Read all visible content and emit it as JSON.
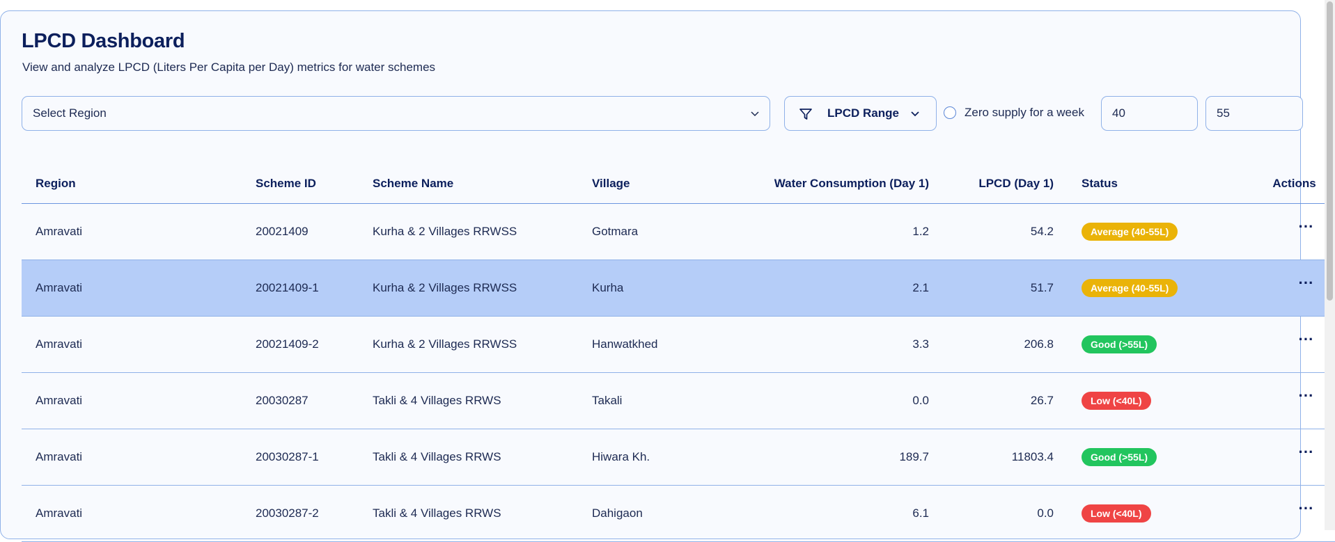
{
  "header": {
    "title": "LPCD Dashboard",
    "subtitle": "View and analyze LPCD (Liters Per Capita per Day) metrics for water schemes"
  },
  "filters": {
    "region_select": {
      "label": "Select Region",
      "icon": "chevron-down-icon"
    },
    "lpcd_range": {
      "label": "LPCD Range",
      "icon": "filter-icon",
      "chevron": "chevron-down-icon"
    },
    "zero_supply": {
      "label": "Zero supply for a week",
      "checked": false
    },
    "min_value": "40",
    "max_value": "55"
  },
  "table": {
    "columns": [
      "Region",
      "Scheme ID",
      "Scheme Name",
      "Village",
      "Water Consumption (Day 1)",
      "LPCD (Day 1)",
      "Status",
      "Actions"
    ],
    "rows": [
      {
        "region": "Amravati",
        "scheme_id": "20021409",
        "scheme_name": "Kurha & 2 Villages RRWSS",
        "village": "Gotmara",
        "water": "1.2",
        "lpcd": "54.2",
        "status": "Average (40-55L)",
        "status_type": "average",
        "selected": false
      },
      {
        "region": "Amravati",
        "scheme_id": "20021409-1",
        "scheme_name": "Kurha & 2 Villages RRWSS",
        "village": "Kurha",
        "water": "2.1",
        "lpcd": "51.7",
        "status": "Average (40-55L)",
        "status_type": "average",
        "selected": true
      },
      {
        "region": "Amravati",
        "scheme_id": "20021409-2",
        "scheme_name": "Kurha & 2 Villages RRWSS",
        "village": "Hanwatkhed",
        "water": "3.3",
        "lpcd": "206.8",
        "status": "Good (>55L)",
        "status_type": "good",
        "selected": false
      },
      {
        "region": "Amravati",
        "scheme_id": "20030287",
        "scheme_name": "Takli & 4 Villages RRWS",
        "village": "Takali",
        "water": "0.0",
        "lpcd": "26.7",
        "status": "Low (<40L)",
        "status_type": "low",
        "selected": false
      },
      {
        "region": "Amravati",
        "scheme_id": "20030287-1",
        "scheme_name": "Takli & 4 Villages RRWS",
        "village": "Hiwara Kh.",
        "water": "189.7",
        "lpcd": "11803.4",
        "status": "Good (>55L)",
        "status_type": "good",
        "selected": false
      },
      {
        "region": "Amravati",
        "scheme_id": "20030287-2",
        "scheme_name": "Takli & 4 Villages RRWS",
        "village": "Dahigaon",
        "water": "6.1",
        "lpcd": "0.0",
        "status": "Low (<40L)",
        "status_type": "low",
        "selected": false
      }
    ],
    "actions_icon": "more-horizontal-icon"
  },
  "colors": {
    "average": "#eab308",
    "good": "#22c55e",
    "low": "#ef4444",
    "selected_row": "#b5cdf8",
    "border": "#8fb1e8",
    "text_primary": "#0c1f5c"
  }
}
